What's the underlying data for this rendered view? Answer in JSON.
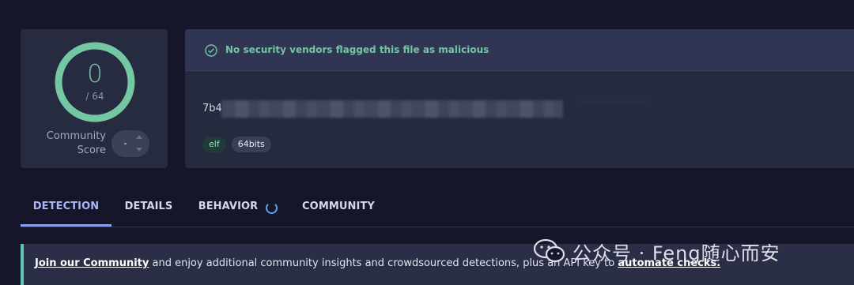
{
  "colors": {
    "background": "#16162a",
    "card": "#262b40",
    "accent_green": "#73c7a3",
    "accent_blue": "#8a9ff2",
    "notice_border": "#62c4b6"
  },
  "score_card": {
    "score": "0",
    "total": "/ 64",
    "community_label_line1": "Community",
    "community_label_line2": "Score",
    "vote_value": "-"
  },
  "file_card": {
    "status_icon": "check-circle-icon",
    "status_text": "No security vendors flagged this file as malicious",
    "hash_visible_prefix": "7b4",
    "tags": [
      "elf",
      "64bits"
    ]
  },
  "tabs": [
    {
      "label": "DETECTION",
      "active": true
    },
    {
      "label": "DETAILS",
      "active": false
    },
    {
      "label": "BEHAVIOR",
      "active": false,
      "loading": true
    },
    {
      "label": "COMMUNITY",
      "active": false
    }
  ],
  "notice": {
    "link1": "Join our Community",
    "text": " and enjoy additional community insights and crowdsourced detections, plus an API key to ",
    "link2": "automate checks."
  },
  "watermark": {
    "icon": "wechat-icon",
    "text": "公众号 · Feng随心而安"
  }
}
